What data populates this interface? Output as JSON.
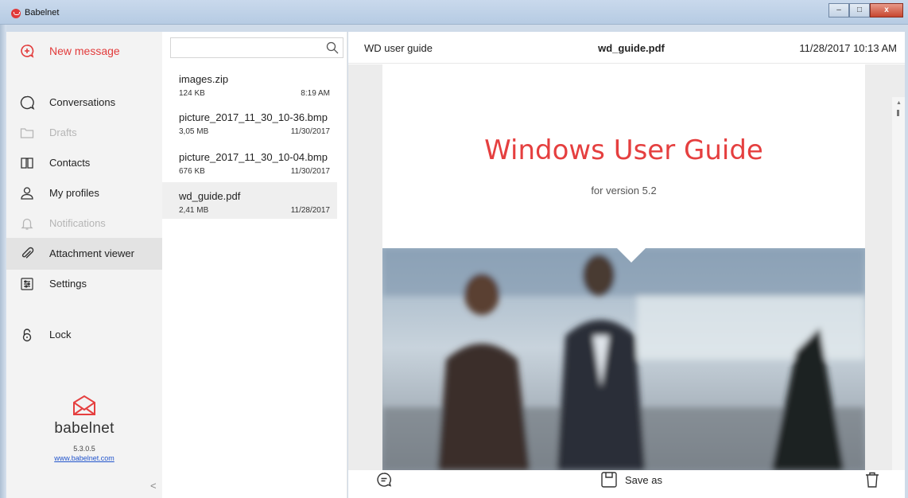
{
  "window": {
    "title": "Babelnet",
    "controls": {
      "minimize": "–",
      "maximize": "□",
      "close": "x"
    }
  },
  "sidebar": {
    "new_message": {
      "label": "New message",
      "icon": "new-message-icon"
    },
    "items": [
      {
        "label": "Conversations",
        "icon": "chat-bubble-icon",
        "enabled": true
      },
      {
        "label": "Drafts",
        "icon": "folder-icon",
        "enabled": false
      },
      {
        "label": "Contacts",
        "icon": "book-icon",
        "enabled": true
      },
      {
        "label": "My profiles",
        "icon": "person-icon",
        "enabled": true
      },
      {
        "label": "Notifications",
        "icon": "bell-icon",
        "enabled": false
      },
      {
        "label": "Attachment viewer",
        "icon": "paperclip-icon",
        "enabled": true,
        "active": true
      },
      {
        "label": "Settings",
        "icon": "settings-icon",
        "enabled": true
      }
    ],
    "lock": {
      "label": "Lock",
      "icon": "lock-icon"
    },
    "brand": {
      "name": "babelnet",
      "version": "5.3.0.5",
      "website": "www.babelnet.com"
    },
    "collapse": "<"
  },
  "file_list": {
    "search": {
      "placeholder": "",
      "value": ""
    },
    "files": [
      {
        "name": "images.zip",
        "size": "124 KB",
        "date": "8:19 AM",
        "selected": false
      },
      {
        "name": "picture_2017_11_30_10-36.bmp",
        "size": "3,05 MB",
        "date": "11/30/2017",
        "selected": false
      },
      {
        "name": "picture_2017_11_30_10-04.bmp",
        "size": "676 KB",
        "date": "11/30/2017",
        "selected": false
      },
      {
        "name": "wd_guide.pdf",
        "size": "2,41 MB",
        "date": "11/28/2017",
        "selected": true
      }
    ]
  },
  "viewer": {
    "subject": "WD user guide",
    "filename": "wd_guide.pdf",
    "datetime": "11/28/2017 10:13 AM",
    "document": {
      "title": "Windows User Guide",
      "subtitle": "for version 5.2"
    },
    "footer": {
      "save_label": "Save as"
    }
  },
  "colors": {
    "accent": "#e53f3f",
    "sidebar_bg": "#f3f3f3",
    "active_item_bg": "#e3e3e3",
    "link": "#2255cc"
  }
}
